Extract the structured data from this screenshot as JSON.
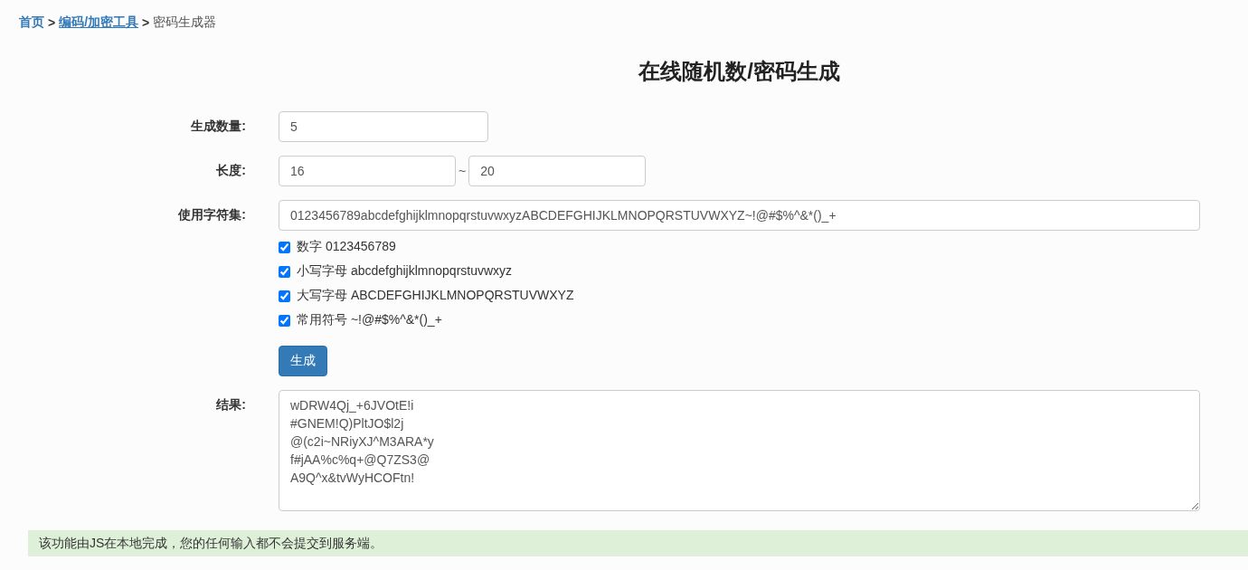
{
  "breadcrumb": [
    {
      "label": "首页",
      "kind": "home"
    },
    {
      "label": "编码/加密工具",
      "kind": "link"
    },
    {
      "label": "密码生成器",
      "kind": "current"
    }
  ],
  "breadcrumb_separator": ">",
  "title": "在线随机数/密码生成",
  "count": {
    "label": "生成数量:",
    "value": "5"
  },
  "length": {
    "label": "长度:",
    "min": "16",
    "separator": "~",
    "max": "20"
  },
  "charset": {
    "label": "使用字符集:",
    "value": "0123456789abcdefghijklmnopqrstuvwxyzABCDEFGHIJKLMNOPQRSTUVWXYZ~!@#$%^&*()_+"
  },
  "options": [
    {
      "label": "数字 0123456789",
      "checked": true
    },
    {
      "label": "小写字母 abcdefghijklmnopqrstuvwxyz",
      "checked": true
    },
    {
      "label": "大写字母 ABCDEFGHIJKLMNOPQRSTUVWXYZ",
      "checked": true
    },
    {
      "label": "常用符号 ~!@#$%^&*()_+",
      "checked": true
    }
  ],
  "generate_button": "生成",
  "result": {
    "label": "结果:",
    "value": "wDRW4Qj_+6JVOtE!i\n#GNEM!Q)PltJO$l2j\n@(c2i~NRiyXJ^M3ARA*y\nf#jAA%c%q+@Q7ZS3@\nA9Q^x&tvWyHCOFtn!"
  },
  "notice": "该功能由JS在本地完成，您的任何输入都不会提交到服务端。"
}
